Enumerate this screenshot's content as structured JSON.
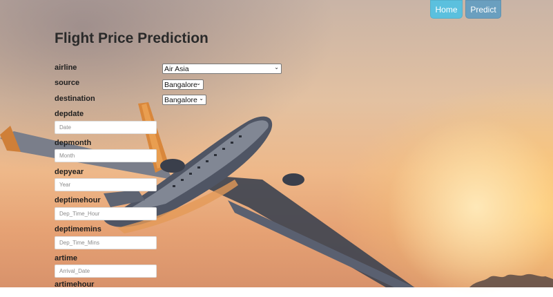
{
  "nav": {
    "home_label": "Home",
    "predict_label": "Predict"
  },
  "page": {
    "title": "Flight Price Prediction"
  },
  "form": {
    "airline": {
      "label": "airline",
      "value": "Air Asia"
    },
    "source": {
      "label": "source",
      "value": "Bangalore"
    },
    "destination": {
      "label": "destination",
      "value": "Bangalore"
    },
    "depdate": {
      "label": "depdate",
      "placeholder": "Date"
    },
    "depmonth": {
      "label": "depmonth",
      "placeholder": "Month"
    },
    "depyear": {
      "label": "depyear",
      "placeholder": "Year"
    },
    "deptimehour": {
      "label": "deptimehour",
      "placeholder": "Dep_Time_Hour"
    },
    "deptimemins": {
      "label": "deptimemins",
      "placeholder": "Dep_Time_Mins"
    },
    "artime": {
      "label": "artime",
      "placeholder": "Arrival_Date"
    },
    "artimehour": {
      "label": "artimehour"
    }
  },
  "colors": {
    "home_button": "#5bc0de",
    "predict_button": "#6a9fbf"
  }
}
